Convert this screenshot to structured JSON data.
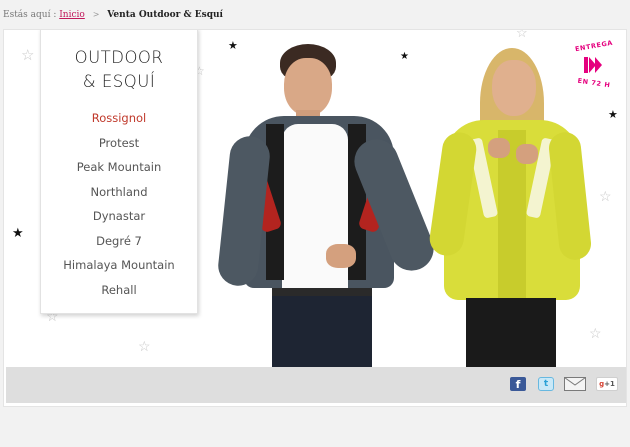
{
  "breadcrumb": {
    "prefix": "Estás aquí :",
    "home_label": "Inicio",
    "separator": ">",
    "current": "Venta Outdoor & Esquí"
  },
  "menu": {
    "title_line1": "OUTDOOR",
    "title_line2": "& ESQUÍ",
    "items": [
      {
        "label": "Rossignol",
        "active": true
      },
      {
        "label": "Protest"
      },
      {
        "label": "Peak Mountain"
      },
      {
        "label": "Northland"
      },
      {
        "label": "Dynastar"
      },
      {
        "label": "Degré 7"
      },
      {
        "label": "Himalaya Mountain"
      },
      {
        "label": "Rehall"
      }
    ]
  },
  "badge": {
    "top_text": "ENTREGA",
    "bottom_text": "EN 72 H",
    "color": "#e5007e"
  },
  "share": {
    "facebook_glyph": "f",
    "twitter_glyph": "t",
    "gplus_glyph_g": "g",
    "gplus_glyph_plus": "+1",
    "icons": [
      "facebook-icon",
      "twitter-icon",
      "mail-icon",
      "google-plus-icon"
    ]
  },
  "colors": {
    "accent": "#c2185b",
    "active_item": "#c0392b",
    "jacket_man": "#4a5560",
    "jacket_man_accent": "#b3241f",
    "jacket_woman": "#d9dd3a"
  }
}
